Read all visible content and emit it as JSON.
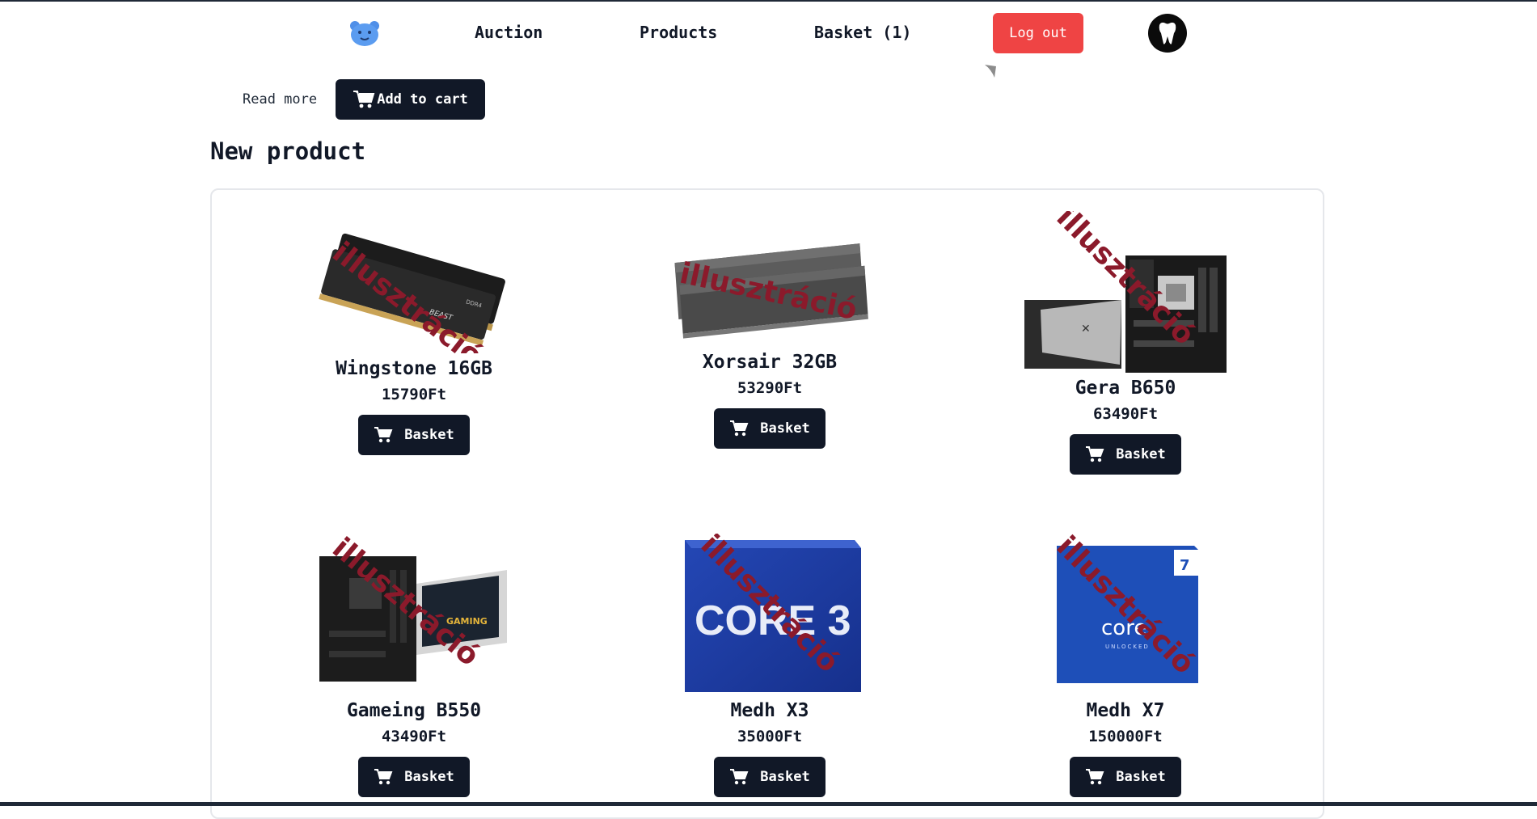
{
  "header": {
    "nav": {
      "auction": "Auction",
      "products": "Products",
      "basket": "Basket (1)"
    },
    "logout_label": "Log out"
  },
  "top_actions": {
    "read_more": "Read more",
    "add_to_cart": "Add to cart"
  },
  "section_title": "New product",
  "products": [
    {
      "name": "Wingstone 16GB",
      "price": "15790Ft",
      "button": "Basket",
      "watermark": "illusztráció"
    },
    {
      "name": "Xorsair 32GB",
      "price": "53290Ft",
      "button": "Basket",
      "watermark": "illusztráció"
    },
    {
      "name": "Gera B650",
      "price": "63490Ft",
      "button": "Basket",
      "watermark": "illusztráció"
    },
    {
      "name": "Gameing B550",
      "price": "43490Ft",
      "button": "Basket",
      "watermark": "illusztráció"
    },
    {
      "name": "Medh X3",
      "price": "35000Ft",
      "button": "Basket",
      "watermark": "illusztráció"
    },
    {
      "name": "Medh X7",
      "price": "150000Ft",
      "button": "Basket",
      "watermark": "illusztráció"
    }
  ],
  "image_text": {
    "ram_label_1": "DDR4",
    "ram_label_2": "BEAST",
    "cpu3_text": "CORE 3",
    "cpu7_text": "core",
    "cpu7_sub": "UNLOCKED",
    "cpu7_badge": "7",
    "mobo_box_text": "GAMING"
  },
  "colors": {
    "accent_dark": "#111827",
    "logout_red": "#ef4444",
    "watermark": "#8b1a2b",
    "intel_blue": "#1e4fb8"
  }
}
